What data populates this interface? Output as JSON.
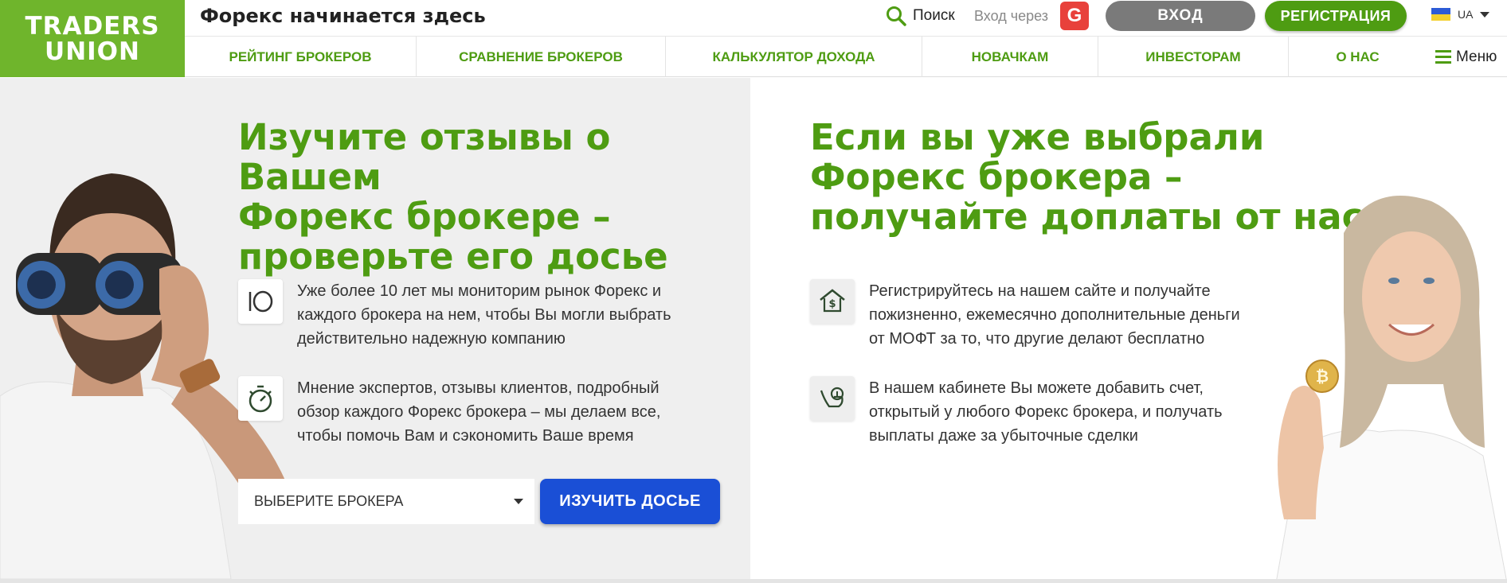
{
  "header": {
    "logo_line1": "TRADERS",
    "logo_line2": "UNION",
    "slogan": "Форекс начинается здесь",
    "search_label": "Поиск",
    "login_via": "Вход через",
    "google_letter": "G",
    "login_button": "ВХОД",
    "register_button": "РЕГИСТРАЦИЯ",
    "language": "UA",
    "menu_label": "Меню"
  },
  "nav": {
    "items": [
      {
        "label": "РЕЙТИНГ БРОКЕРОВ"
      },
      {
        "label": "СРАВНЕНИЕ БРОКЕРОВ"
      },
      {
        "label": "КАЛЬКУЛЯТОР ДОХОДА"
      },
      {
        "label": "НОВАЧКАМ"
      },
      {
        "label": "ИНВЕСТОРАМ"
      },
      {
        "label": "О НАС"
      }
    ]
  },
  "left": {
    "title_lines": [
      "Изучите отзывы о Вашем",
      "Форекс брокере –",
      "проверьте его досье"
    ],
    "features": [
      {
        "icon": "ten-years-icon",
        "lines": [
          "Уже более 10 лет мы мониторим рынок Форекс и",
          "каждого брокера на нем, чтобы Вы могли выбрать",
          "действительно надежную компанию"
        ]
      },
      {
        "icon": "stopwatch-icon",
        "lines": [
          "Мнение экспертов, отзывы клиентов, подробный",
          "обзор каждого Форекс брокера – мы делаем все,",
          "чтобы помочь Вам и сэкономить Ваше время"
        ]
      }
    ],
    "select_value": "ВЫБЕРИТЕ БРОКЕРА",
    "dossier_button": "ИЗУЧИТЬ ДОСЬЕ"
  },
  "right": {
    "title_lines": [
      "Если вы уже выбрали",
      "Форекс брокера –",
      "получайте доплаты от нас"
    ],
    "features": [
      {
        "icon": "money-house-icon",
        "lines": [
          "Регистрируйтесь на нашем сайте и получайте",
          "пожизненно, ежемесячно дополнительные деньги",
          "от МОФТ за то, что другие делают бесплатно"
        ]
      },
      {
        "icon": "hand-coin-icon",
        "lines": [
          "В нашем кабинете Вы можете добавить счет,",
          "открытый у любого Форекс брокера, и получать",
          "выплаты даже за убыточные сделки"
        ]
      }
    ]
  },
  "colors": {
    "brand_green": "#6fb52c",
    "text_green": "#4e9c12",
    "blue_button": "#1a4fd6",
    "google_red": "#e8413b"
  }
}
